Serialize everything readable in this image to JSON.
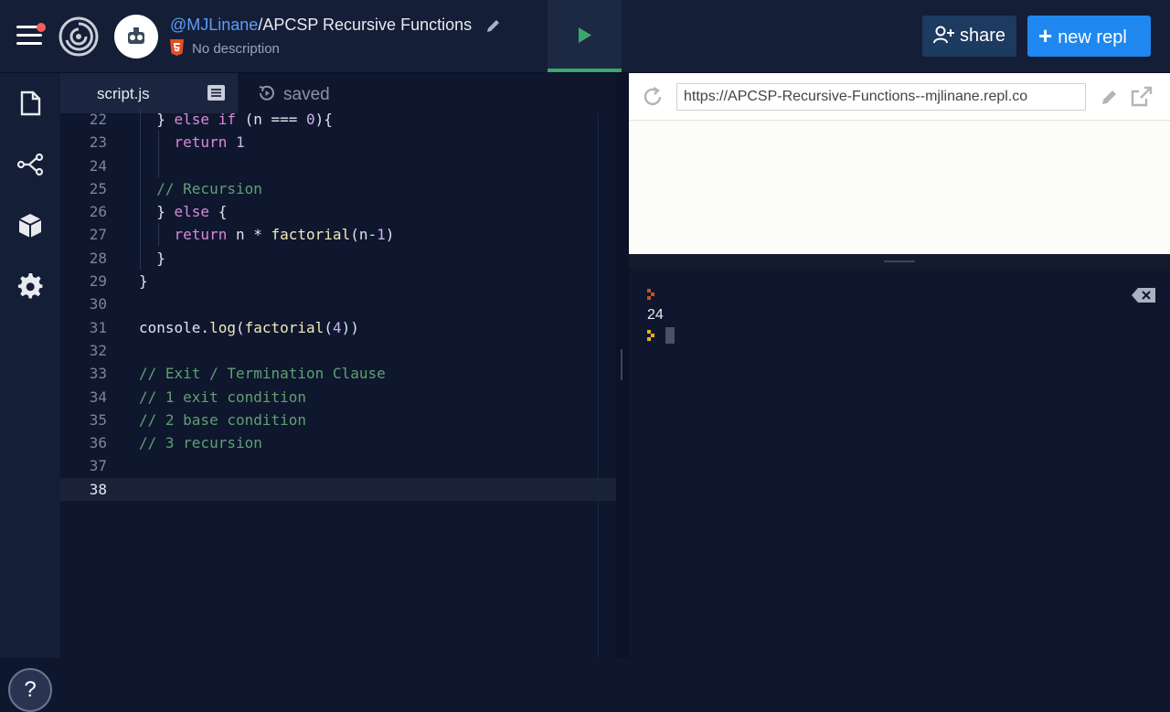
{
  "header": {
    "username": "@MJLinane",
    "separator": "/",
    "repl_name": "APCSP Recursive Functions",
    "description": "No description",
    "share_label": "share",
    "new_repl_label": "new repl"
  },
  "editor": {
    "tab_label": "script.js",
    "save_status": "saved",
    "current_line": 38,
    "lines": [
      {
        "n": "22",
        "html": "  } <span class='kw'>else if</span> (n === <span class='num'>0</span>){"
      },
      {
        "n": "23",
        "html": "    <span class='kw'>return</span> <span class='num'>1</span>"
      },
      {
        "n": "24",
        "html": ""
      },
      {
        "n": "25",
        "html": "  <span class='cm'>// Recursion</span>"
      },
      {
        "n": "26",
        "html": "  } <span class='kw'>else</span> {"
      },
      {
        "n": "27",
        "html": "    <span class='kw'>return</span> n * <span class='fn'>factorial</span>(n-<span class='num'>1</span>)"
      },
      {
        "n": "28",
        "html": "  }"
      },
      {
        "n": "29",
        "html": "}"
      },
      {
        "n": "30",
        "html": ""
      },
      {
        "n": "31",
        "html": "console.<span class='fn'>log</span>(<span class='fn'>factorial</span>(<span class='num'>4</span>))"
      },
      {
        "n": "32",
        "html": ""
      },
      {
        "n": "33",
        "html": "<span class='cm'>// Exit / Termination Clause</span>"
      },
      {
        "n": "34",
        "html": "<span class='cm'>// 1 exit condition</span>"
      },
      {
        "n": "35",
        "html": "<span class='cm'>// 2 base condition</span>"
      },
      {
        "n": "36",
        "html": "<span class='cm'>// 3 recursion</span>"
      },
      {
        "n": "37",
        "html": ""
      },
      {
        "n": "38",
        "html": ""
      }
    ]
  },
  "browser": {
    "url": "https://APCSP-Recursive-Functions--mjlinane.repl.co"
  },
  "console": {
    "output": "24"
  },
  "help_label": "?",
  "colors": {
    "accent": "#1e88f0",
    "run_indicator": "#3aa76d",
    "username": "#5d9cf8"
  },
  "icons": {
    "sidebar": [
      "files-icon",
      "version-control-icon",
      "packages-icon",
      "settings-icon"
    ]
  }
}
